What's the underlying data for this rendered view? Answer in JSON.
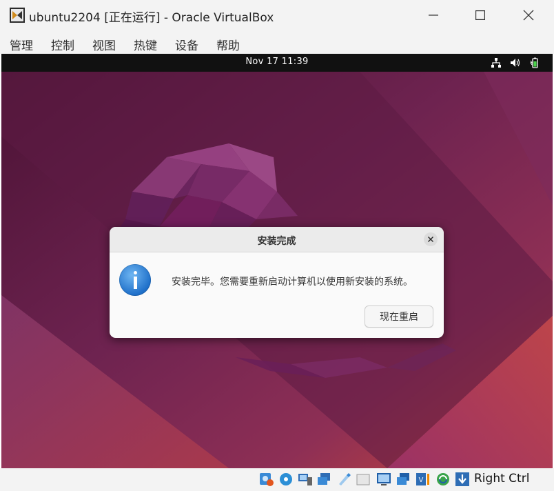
{
  "window": {
    "title": "ubuntu2204 [正在运行] - Oracle VirtualBox"
  },
  "menubar": {
    "items": [
      "管理",
      "控制",
      "视图",
      "热键",
      "设备",
      "帮助"
    ]
  },
  "vm": {
    "topbar": {
      "clock": "Nov 17  11:39"
    },
    "dialog": {
      "title": "安装完成",
      "message": "安装完毕。您需要重新启动计算机以使用新安装的系统。",
      "restart_button": "现在重启"
    }
  },
  "statusbar": {
    "host_key": "Right Ctrl",
    "icons": [
      "optical-disk-icon",
      "audio-icon",
      "network-icon",
      "usb-icon",
      "shared-folder-icon",
      "display-icon",
      "screen-capture-icon",
      "vm-state-icon",
      "mouse-integration-icon",
      "download-icon"
    ]
  },
  "colors": {
    "window_chrome": "#f3f3f3",
    "ubuntu_purple": "#5a1d3f",
    "ubuntu_orange": "#c8463a",
    "info_blue": "#1e6fc9"
  }
}
